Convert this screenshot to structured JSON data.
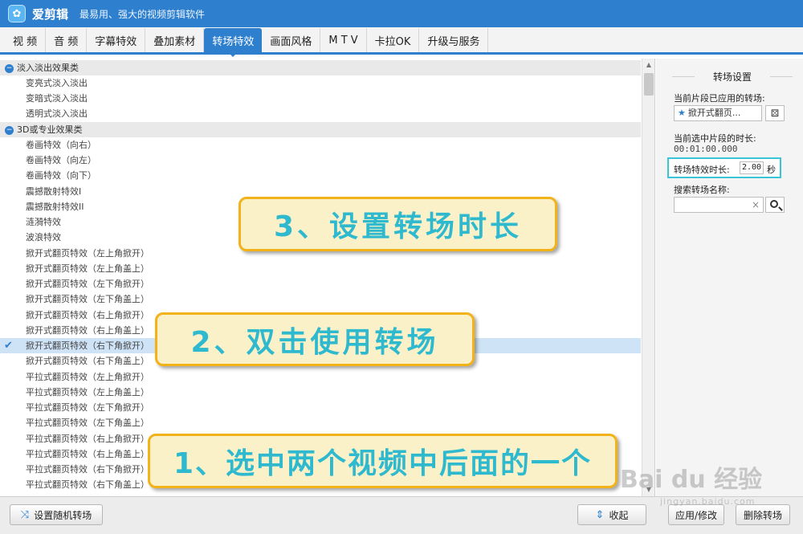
{
  "app": {
    "logo_glyph": "✿",
    "name": "爱剪辑",
    "slogan": "最易用、强大的视频剪辑软件"
  },
  "tabs": [
    {
      "label": "视  频",
      "active": false
    },
    {
      "label": "音  频",
      "active": false
    },
    {
      "label": "字幕特效",
      "active": false
    },
    {
      "label": "叠加素材",
      "active": false
    },
    {
      "label": "转场特效",
      "active": true
    },
    {
      "label": "画面风格",
      "active": false
    },
    {
      "label": "M T V",
      "active": false
    },
    {
      "label": "卡拉OK",
      "active": false
    },
    {
      "label": "升级与服务",
      "active": false
    }
  ],
  "list": {
    "groups": [
      {
        "toggle": "−",
        "label": "淡入淡出效果类"
      },
      {
        "toggle": "−",
        "label": "3D或专业效果类"
      }
    ],
    "items": [
      "变亮式淡入淡出",
      "变暗式淡入淡出",
      "透明式淡入淡出",
      "卷画特效（向右）",
      "卷画特效（向左）",
      "卷画特效（向下）",
      "震撼散射特效I",
      "震撼散射特效II",
      "涟漪特效",
      "波浪特效",
      "掀开式翻页特效（左上角掀开）",
      "掀开式翻页特效（左上角盖上）",
      "掀开式翻页特效（左下角掀开）",
      "掀开式翻页特效（左下角盖上）",
      "掀开式翻页特效（右上角掀开）",
      "掀开式翻页特效（右上角盖上）",
      "掀开式翻页特效（右下角掀开）",
      "掀开式翻页特效（右下角盖上）",
      "平拉式翻页特效（左上角掀开）",
      "平拉式翻页特效（左上角盖上）",
      "平拉式翻页特效（左下角掀开）",
      "平拉式翻页特效（左下角盖上）",
      "平拉式翻页特效（右上角掀开）",
      "平拉式翻页特效（右上角盖上）",
      "平拉式翻页特效（右下角掀开）",
      "平拉式翻页特效（右下角盖上）"
    ],
    "selected_item": "掀开式翻页特效（右下角掀开）",
    "check_glyph": "✔"
  },
  "settings": {
    "title": "转场设置",
    "applied_label": "当前片段已应用的转场:",
    "applied_value": "掀开式翻页...",
    "applied_icon": "★",
    "dice_icon": "⚄",
    "clip_duration_label": "当前选中片段的时长:",
    "clip_duration_value": "00:01:00.000",
    "fx_duration_label": "转场特效时长:",
    "fx_duration_value": "2.00",
    "fx_duration_unit": "秒",
    "search_label": "搜索转场名称:",
    "search_value": "",
    "search_clear": "×"
  },
  "bottom": {
    "random_label": "设置随机转场",
    "random_icon": "⤨",
    "collapse_label": "收起",
    "collapse_icon": "⇕",
    "apply_label": "应用/修改",
    "delete_label": "删除转场"
  },
  "annotations": {
    "step3": "3、设置转场时长",
    "step2": "2、双击使用转场",
    "step1": "1、选中两个视频中后面的一个"
  },
  "watermark": {
    "main": "Bai du 经验",
    "sub": "jingyan.baidu.com"
  },
  "colors": {
    "accent": "#2f7fcf",
    "highlight_box": "#39c4d8",
    "annotation_border": "#f1b21a",
    "annotation_text": "#2fb9cf",
    "selected_row": "#cfe3f7"
  }
}
